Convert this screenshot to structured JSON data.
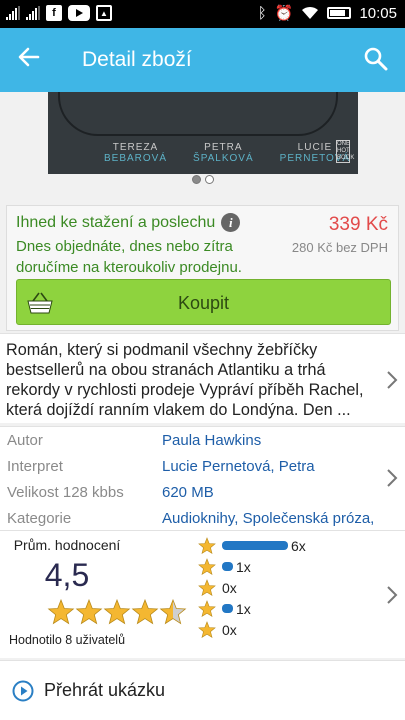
{
  "status_bar": {
    "time": "10:05",
    "icons": [
      "signal-icon",
      "signal-icon",
      "facebook-icon",
      "youtube-icon",
      "image-icon",
      "bluetooth-icon",
      "alarm-icon",
      "wifi-icon",
      "battery-icon"
    ]
  },
  "app_bar": {
    "title": "Detail zboží",
    "back_icon": "arrow-left-icon",
    "search_icon": "search-icon",
    "color": "#3fb6e6"
  },
  "cover": {
    "narrators": [
      {
        "first": "TEREZA",
        "last": "BEBAROVÁ"
      },
      {
        "first": "PETRA",
        "last": "ŠPALKOVÁ"
      },
      {
        "first": "LUCIE",
        "last": "PERNETOVÁ"
      }
    ],
    "publisher_badge": "ONE HOT BOOK",
    "page_indicator": {
      "pages": 2,
      "active": 1
    }
  },
  "purchase": {
    "availability": "Ihned ke stažení a poslechu",
    "delivery": "Dnes objednáte, dnes nebo zítra doručíme na kteroukoliv prodejnu.",
    "price": "339 Kč",
    "price_without_vat": "280 Kč bez DPH",
    "buy_label": "Koupit",
    "price_color": "#e24a4a",
    "availability_color": "#3b8a24",
    "button_color": "#8ed33e"
  },
  "description": {
    "text": "Román, který si podmanil všechny žebříčky bestsellerů na obou stranách Atlantiku a trhá rekordy v rychlosti prodeje Vypráví příběh Rachel, která dojíždí ranním vlakem do Londýna. Den ..."
  },
  "meta": {
    "rows": [
      {
        "key": "Autor",
        "value": "Paula Hawkins"
      },
      {
        "key": "Interpret",
        "value": "Lucie Pernetová, Petra"
      },
      {
        "key": "Velikost 128 kbbs",
        "value": "620 MB"
      },
      {
        "key": "Kategorie",
        "value": "Audioknihy, Společenská próza,"
      }
    ]
  },
  "rating": {
    "label": "Prům. hodnocení",
    "average": "4,5",
    "average_value": 4.5,
    "max": 5,
    "count_text": "Hodnotilo 8 uživatelů",
    "distribution": [
      {
        "count": "6x",
        "value": 6
      },
      {
        "count": "1x",
        "value": 1
      },
      {
        "count": "0x",
        "value": 0
      },
      {
        "count": "1x",
        "value": 1
      },
      {
        "count": "0x",
        "value": 0
      }
    ],
    "bar_color": "#2277c4",
    "star_color": "#f4b731"
  },
  "preview": {
    "label": "Přehrát ukázku"
  }
}
